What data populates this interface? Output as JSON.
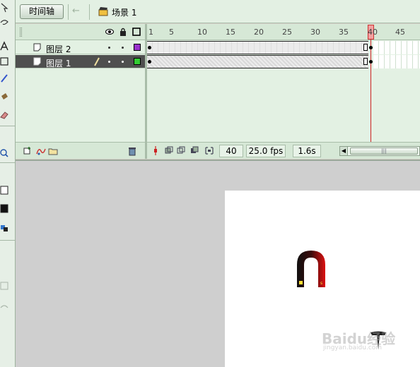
{
  "header": {
    "timeline_button": "时间轴",
    "scene_label": "场景 1"
  },
  "layers": [
    {
      "name": "图层 2",
      "color": "#9933cc",
      "selected": false
    },
    {
      "name": "图层 1",
      "color": "#33cc33",
      "selected": true
    }
  ],
  "ruler": {
    "labels": [
      "1",
      "5",
      "10",
      "15",
      "20",
      "25",
      "30",
      "35",
      "40",
      "45"
    ]
  },
  "status": {
    "current_frame": "40",
    "frame_rate": "25.0 fps",
    "elapsed_time": "1.6s"
  },
  "stage": {
    "magnet_pole_label": "s"
  },
  "watermark": {
    "text": "Baidu经验",
    "url": "jingyan.baidu.com"
  }
}
